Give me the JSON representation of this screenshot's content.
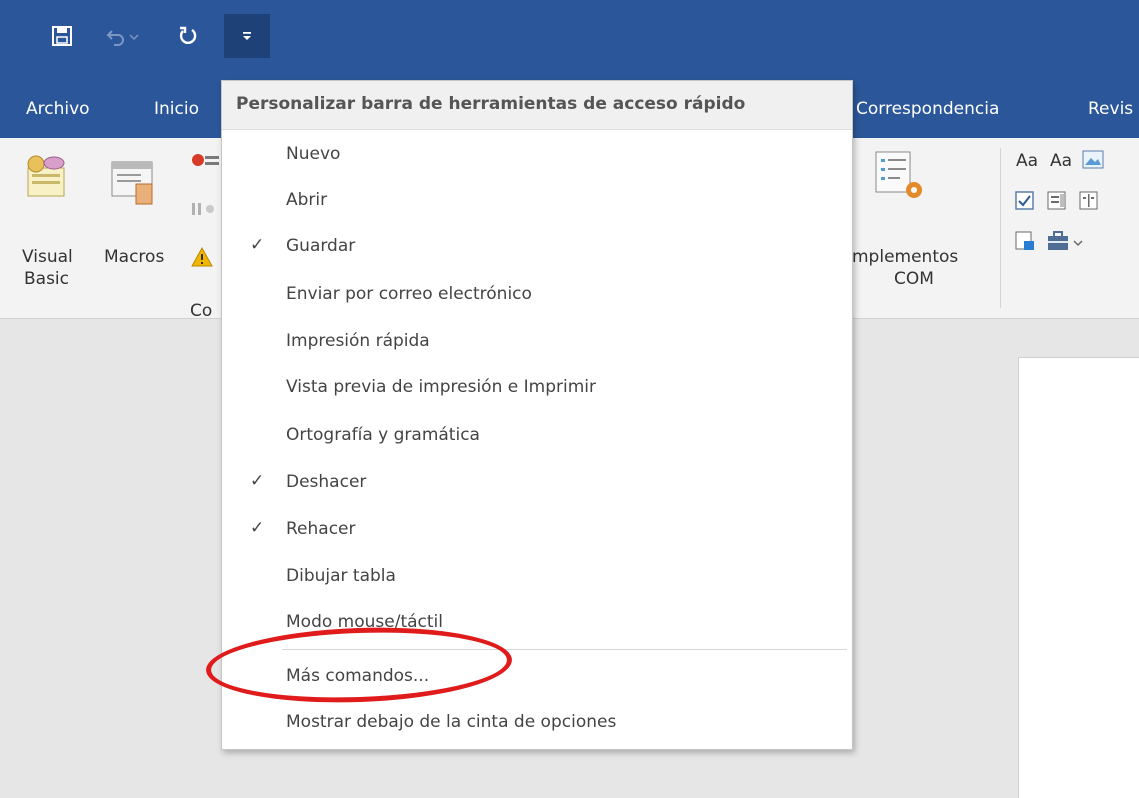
{
  "quick_access": {
    "save_icon": "save-icon",
    "undo_icon": "undo-icon",
    "redo_icon": "redo-icon",
    "customize_icon": "customize-qat-icon"
  },
  "tabs": [
    {
      "label": "Archivo"
    },
    {
      "label": "Inicio"
    },
    {
      "label": "Correspondencia"
    },
    {
      "label": "Revis"
    }
  ],
  "ribbon": {
    "visual_basic_line1": "Visual",
    "visual_basic_line2": "Basic",
    "macros": "Macros",
    "group_label_fragment": "Co",
    "complements_line1": "mplementos",
    "complements_line2": "COM",
    "font_sample_1": "Aa",
    "font_sample_2": "Aa"
  },
  "menu": {
    "header": "Personalizar barra de herramientas de acceso rápido",
    "items": [
      {
        "label": "Nuevo",
        "checked": false
      },
      {
        "label": "Abrir",
        "checked": false
      },
      {
        "label": "Guardar",
        "checked": true
      },
      {
        "label": "Enviar por correo electrónico",
        "checked": false
      },
      {
        "label": "Impresión rápida",
        "checked": false
      },
      {
        "label": "Vista previa de impresión e Imprimir",
        "checked": false
      },
      {
        "label": "Ortografía y gramática",
        "checked": false
      },
      {
        "label": "Deshacer",
        "checked": true
      },
      {
        "label": "Rehacer",
        "checked": true
      },
      {
        "label": "Dibujar tabla",
        "checked": false
      },
      {
        "label": "Modo mouse/táctil",
        "checked": false
      }
    ],
    "more_commands": "Más comandos...",
    "show_below": "Mostrar debajo de la cinta de opciones",
    "check_glyph": "✓"
  },
  "colors": {
    "title_blue": "#2b579a",
    "highlight_red": "#e01b1b"
  }
}
